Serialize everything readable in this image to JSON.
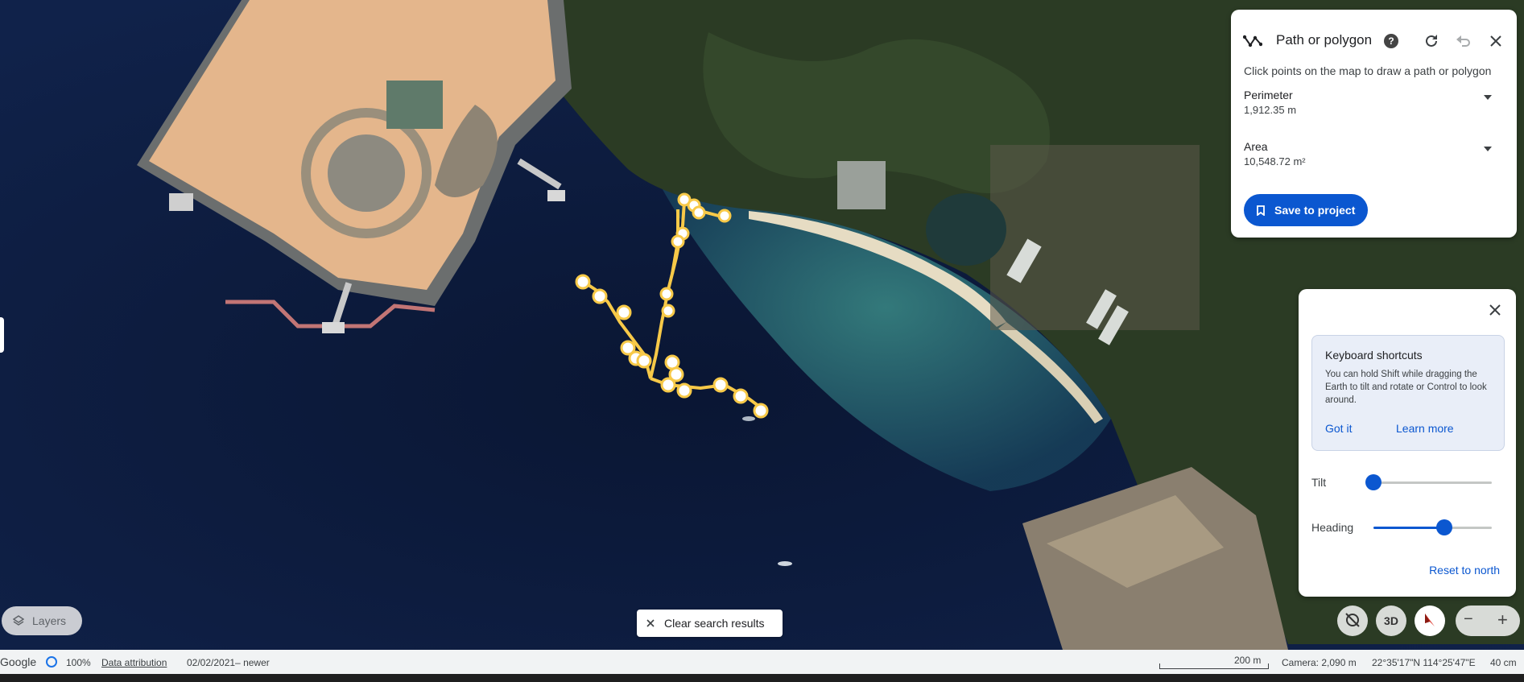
{
  "measure_panel": {
    "title": "Path or polygon",
    "hint": "Click points on the map to draw a path or polygon",
    "perimeter_label": "Perimeter",
    "perimeter_value": "1,912.35 m",
    "area_label": "Area",
    "area_value": "10,548.72 m²",
    "save_label": "Save to project",
    "accent": "#0b57d0"
  },
  "view_panel": {
    "tip_title": "Keyboard shortcuts",
    "tip_body": "You can hold Shift while dragging the Earth to tilt and rotate or Control to look around.",
    "got_it": "Got it",
    "learn_more": "Learn more",
    "tilt_label": "Tilt",
    "tilt_fraction": 0.0,
    "heading_label": "Heading",
    "heading_fraction": 0.6,
    "reset_label": "Reset to north"
  },
  "map_controls": {
    "layers_label": "Layers",
    "clear_label": "Clear search results",
    "view_3d": "3D",
    "zoom_out": "−",
    "zoom_in": "+"
  },
  "status_bar": {
    "brand": "Google",
    "load_percent": "100%",
    "attribution": "Data attribution",
    "imagery_date": "02/02/2021– newer",
    "scale_label": "200 m",
    "camera": "Camera: 2,090 m",
    "coordinates": "22°35'17\"N 114°25'47\"E",
    "resolution": "40 cm"
  },
  "map_colors": {
    "water": "#0b1a3a",
    "shallow": "#2d6f72",
    "land": "#2d3f26",
    "reclaimed": "#e7b98f",
    "path": "#f7c948"
  }
}
